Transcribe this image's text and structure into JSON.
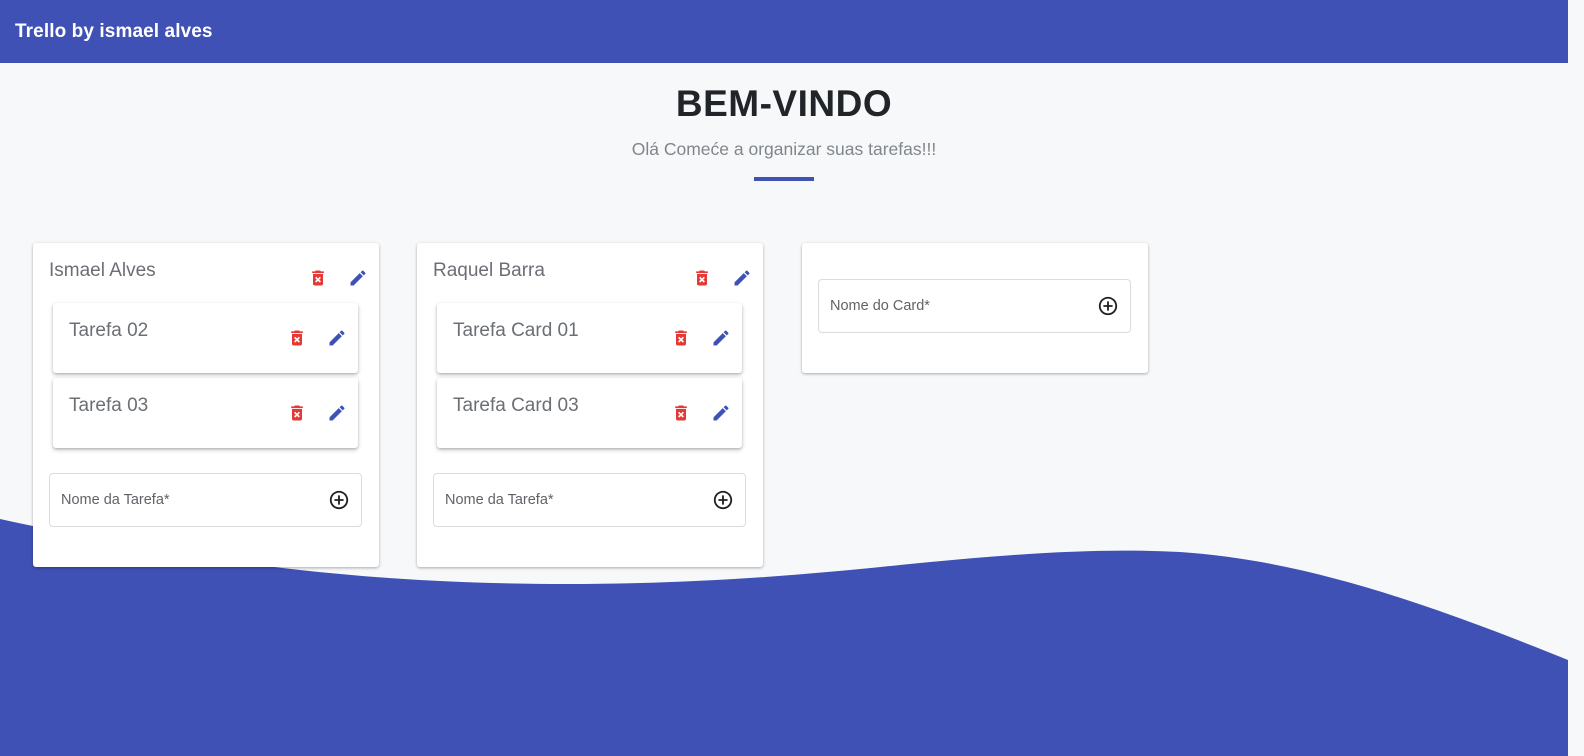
{
  "app": {
    "brand": "Trello by ismael alves"
  },
  "hero": {
    "title": "BEM-VINDO",
    "subtitle": "Olá Comeće a organizar suas tarefas!!!"
  },
  "colors": {
    "primary": "#3f51b5",
    "danger": "#e53935",
    "background": "#f7f8f9"
  },
  "lists": [
    {
      "title": "Ismael Alves",
      "tasks": [
        {
          "title": "Tarefa 02"
        },
        {
          "title": "Tarefa 03"
        }
      ],
      "new_task_placeholder": "Nome da Tarefa*"
    },
    {
      "title": "Raquel Barra",
      "tasks": [
        {
          "title": "Tarefa Card 01"
        },
        {
          "title": "Tarefa Card 03"
        }
      ],
      "new_task_placeholder": "Nome da Tarefa*"
    }
  ],
  "new_list": {
    "placeholder": "Nome do Card*"
  },
  "icons": {
    "delete": "delete-forever-icon",
    "edit": "pencil-icon",
    "add": "add-circle-outline-icon"
  }
}
